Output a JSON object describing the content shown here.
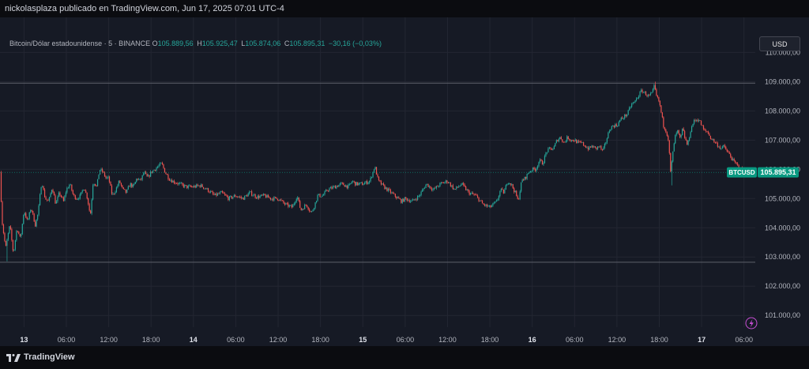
{
  "header": {
    "text": "nickolasplaza publicado en TradingView.com, Jun 17, 2025 07:01 UTC-4"
  },
  "legend": {
    "symbol": "Bitcoin/Dólar estadounidense · 5 · BINANCE",
    "o_label": "O",
    "o": "105.889,56",
    "h_label": "H",
    "h": "105.925,47",
    "l_label": "L",
    "l": "105.874,06",
    "c_label": "C",
    "c": "105.895,31",
    "change": "−30,16 (−0,03%)"
  },
  "currency": "USD",
  "footer": {
    "brand": "TradingView",
    "logo_icon": "tradingview-logo-icon"
  },
  "price_tag": {
    "symbol": "BTCUSD",
    "price": "105.895,31"
  },
  "colors": {
    "up": "#26a69a",
    "down": "#ef5350",
    "tag": "#089981",
    "background": "#161a25",
    "grid": "#232632"
  },
  "chart_data": {
    "type": "candlestick",
    "y_axis": {
      "ticks": [
        101000,
        102000,
        103000,
        104000,
        105000,
        106000,
        107000,
        108000,
        109000,
        110000
      ],
      "tick_labels": [
        "101.000,00",
        "102.000,00",
        "103.000,00",
        "104.000,00",
        "105.000,00",
        "106.000,00",
        "107.000,00",
        "108.000,00",
        "109.000,00",
        "110.000,00"
      ],
      "range": [
        100600,
        111200
      ]
    },
    "x_axis": {
      "ticks": [
        {
          "label": "13",
          "t": 0,
          "bold": true
        },
        {
          "label": "06:00",
          "t": 6,
          "bold": false
        },
        {
          "label": "12:00",
          "t": 12,
          "bold": false
        },
        {
          "label": "18:00",
          "t": 18,
          "bold": false
        },
        {
          "label": "14",
          "t": 24,
          "bold": true
        },
        {
          "label": "06:00",
          "t": 30,
          "bold": false
        },
        {
          "label": "12:00",
          "t": 36,
          "bold": false
        },
        {
          "label": "18:00",
          "t": 42,
          "bold": false
        },
        {
          "label": "15",
          "t": 48,
          "bold": true
        },
        {
          "label": "06:00",
          "t": 54,
          "bold": false
        },
        {
          "label": "12:00",
          "t": 60,
          "bold": false
        },
        {
          "label": "18:00",
          "t": 66,
          "bold": false
        },
        {
          "label": "16",
          "t": 72,
          "bold": true
        },
        {
          "label": "06:00",
          "t": 78,
          "bold": false
        },
        {
          "label": "12:00",
          "t": 84,
          "bold": false
        },
        {
          "label": "18:00",
          "t": 90,
          "bold": false
        },
        {
          "label": "17",
          "t": 96,
          "bold": true
        },
        {
          "label": "06:00",
          "t": 102,
          "bold": false
        }
      ],
      "range": [
        -3.4,
        103.6
      ]
    },
    "horizontal_lines": [
      108950,
      102820
    ],
    "last_price": 105895.31,
    "path": [
      [
        -3.4,
        105900
      ],
      [
        -3.1,
        104200
      ],
      [
        -2.6,
        103300
      ],
      [
        -2.0,
        104100
      ],
      [
        -1.5,
        103100
      ],
      [
        -1.0,
        104000
      ],
      [
        -0.5,
        103600
      ],
      [
        0,
        104600
      ],
      [
        0.5,
        104200
      ],
      [
        1.0,
        104700
      ],
      [
        1.6,
        104100
      ],
      [
        2.0,
        104500
      ],
      [
        2.5,
        105600
      ],
      [
        3.0,
        105000
      ],
      [
        3.5,
        104900
      ],
      [
        4.0,
        105400
      ],
      [
        4.5,
        104800
      ],
      [
        5.0,
        105200
      ],
      [
        5.6,
        104900
      ],
      [
        6.0,
        105300
      ],
      [
        6.5,
        105500
      ],
      [
        7.0,
        105100
      ],
      [
        7.5,
        105000
      ],
      [
        8.0,
        105100
      ],
      [
        8.5,
        105400
      ],
      [
        9.0,
        105000
      ],
      [
        9.4,
        104400
      ],
      [
        9.8,
        105600
      ],
      [
        10.3,
        105400
      ],
      [
        10.7,
        106000
      ],
      [
        11.2,
        105900
      ],
      [
        11.6,
        105700
      ],
      [
        12.0,
        105700
      ],
      [
        12.5,
        105100
      ],
      [
        13.0,
        105300
      ],
      [
        13.5,
        105600
      ],
      [
        14.0,
        105300
      ],
      [
        14.5,
        105200
      ],
      [
        15.0,
        105500
      ],
      [
        15.5,
        105400
      ],
      [
        16.0,
        105700
      ],
      [
        16.5,
        105600
      ],
      [
        17.0,
        105900
      ],
      [
        17.5,
        105700
      ],
      [
        18.0,
        105900
      ],
      [
        18.5,
        106000
      ],
      [
        19.0,
        106100
      ],
      [
        19.5,
        106200
      ],
      [
        20.0,
        105900
      ],
      [
        20.5,
        105700
      ],
      [
        21.0,
        105600
      ],
      [
        22.0,
        105500
      ],
      [
        23.0,
        105400
      ],
      [
        24.0,
        105400
      ],
      [
        25.0,
        105450
      ],
      [
        26.0,
        105300
      ],
      [
        27.0,
        105100
      ],
      [
        28.0,
        105200
      ],
      [
        29.0,
        105000
      ],
      [
        30.0,
        105100
      ],
      [
        31.0,
        105000
      ],
      [
        32.0,
        105200
      ],
      [
        33.0,
        105050
      ],
      [
        34.0,
        105100
      ],
      [
        35.0,
        105000
      ],
      [
        36.0,
        105000
      ],
      [
        37.0,
        104800
      ],
      [
        38.0,
        104700
      ],
      [
        38.7,
        105100
      ],
      [
        39.2,
        104600
      ],
      [
        40.0,
        104800
      ],
      [
        40.7,
        104500
      ],
      [
        41.2,
        104800
      ],
      [
        41.6,
        105100
      ],
      [
        42.3,
        105100
      ],
      [
        43.0,
        105300
      ],
      [
        44.0,
        105400
      ],
      [
        45.0,
        105500
      ],
      [
        46.0,
        105400
      ],
      [
        46.5,
        105600
      ],
      [
        47.0,
        105500
      ],
      [
        48.0,
        105500
      ],
      [
        49.0,
        105600
      ],
      [
        49.7,
        106100
      ],
      [
        50.2,
        105600
      ],
      [
        51.0,
        105400
      ],
      [
        52.0,
        105200
      ],
      [
        53.0,
        105000
      ],
      [
        53.5,
        104900
      ],
      [
        54.0,
        105000
      ],
      [
        55.0,
        104900
      ],
      [
        56.0,
        105100
      ],
      [
        57.0,
        105500
      ],
      [
        58.0,
        105300
      ],
      [
        59.0,
        105500
      ],
      [
        60.0,
        105600
      ],
      [
        61.0,
        105300
      ],
      [
        62.0,
        105500
      ],
      [
        63.0,
        105200
      ],
      [
        64.0,
        105100
      ],
      [
        65.0,
        104800
      ],
      [
        66.0,
        104700
      ],
      [
        67.0,
        104900
      ],
      [
        67.5,
        105300
      ],
      [
        68.0,
        105200
      ],
      [
        68.5,
        105600
      ],
      [
        69.0,
        105500
      ],
      [
        69.6,
        105200
      ],
      [
        70.0,
        104900
      ],
      [
        70.5,
        105600
      ],
      [
        71.0,
        105700
      ],
      [
        71.5,
        105900
      ],
      [
        72.0,
        106000
      ],
      [
        72.5,
        106000
      ],
      [
        73.0,
        106300
      ],
      [
        73.5,
        106200
      ],
      [
        74.0,
        106600
      ],
      [
        74.5,
        106700
      ],
      [
        75.0,
        106700
      ],
      [
        75.5,
        107000
      ],
      [
        76.0,
        107100
      ],
      [
        76.5,
        106900
      ],
      [
        77.0,
        107100
      ],
      [
        77.5,
        107000
      ],
      [
        78.0,
        107000
      ],
      [
        78.5,
        106900
      ],
      [
        79.0,
        106900
      ],
      [
        79.5,
        106800
      ],
      [
        80.0,
        106700
      ],
      [
        80.5,
        106800
      ],
      [
        81.0,
        106700
      ],
      [
        81.5,
        106800
      ],
      [
        82.0,
        106600
      ],
      [
        82.5,
        107000
      ],
      [
        83.0,
        107400
      ],
      [
        83.5,
        107500
      ],
      [
        84.0,
        107500
      ],
      [
        84.5,
        107700
      ],
      [
        85.0,
        107800
      ],
      [
        85.5,
        107900
      ],
      [
        86.0,
        108200
      ],
      [
        86.5,
        108300
      ],
      [
        87.0,
        108500
      ],
      [
        87.5,
        108700
      ],
      [
        88.0,
        108600
      ],
      [
        88.5,
        108500
      ],
      [
        89.0,
        108600
      ],
      [
        89.3,
        108850
      ],
      [
        89.6,
        108500
      ],
      [
        90.0,
        108300
      ],
      [
        90.3,
        107900
      ],
      [
        90.6,
        107500
      ],
      [
        91.0,
        107300
      ],
      [
        91.3,
        107000
      ],
      [
        91.6,
        105900
      ],
      [
        91.9,
        106500
      ],
      [
        92.2,
        107100
      ],
      [
        92.6,
        107300
      ],
      [
        93.0,
        107000
      ],
      [
        93.3,
        107400
      ],
      [
        93.6,
        107100
      ],
      [
        94.0,
        106800
      ],
      [
        94.4,
        107300
      ],
      [
        94.8,
        107600
      ],
      [
        95.2,
        107700
      ],
      [
        95.6,
        107700
      ],
      [
        96.0,
        107500
      ],
      [
        96.4,
        107300
      ],
      [
        96.8,
        107300
      ],
      [
        97.2,
        107100
      ],
      [
        97.6,
        107000
      ],
      [
        98.0,
        106900
      ],
      [
        98.4,
        106800
      ],
      [
        98.8,
        106700
      ],
      [
        99.2,
        106800
      ],
      [
        99.6,
        106600
      ],
      [
        100.0,
        106500
      ],
      [
        100.4,
        106300
      ],
      [
        100.8,
        106200
      ],
      [
        101.2,
        106100
      ],
      [
        101.6,
        106000
      ],
      [
        102.0,
        105950
      ],
      [
        102.4,
        105900
      ],
      [
        102.8,
        105895
      ],
      [
        103.6,
        105895
      ]
    ],
    "wick_extremes": [
      {
        "t": 91.7,
        "low": 105450
      },
      {
        "t": 89.4,
        "high": 109000
      },
      {
        "t": -2.4,
        "low": 102850
      }
    ]
  }
}
